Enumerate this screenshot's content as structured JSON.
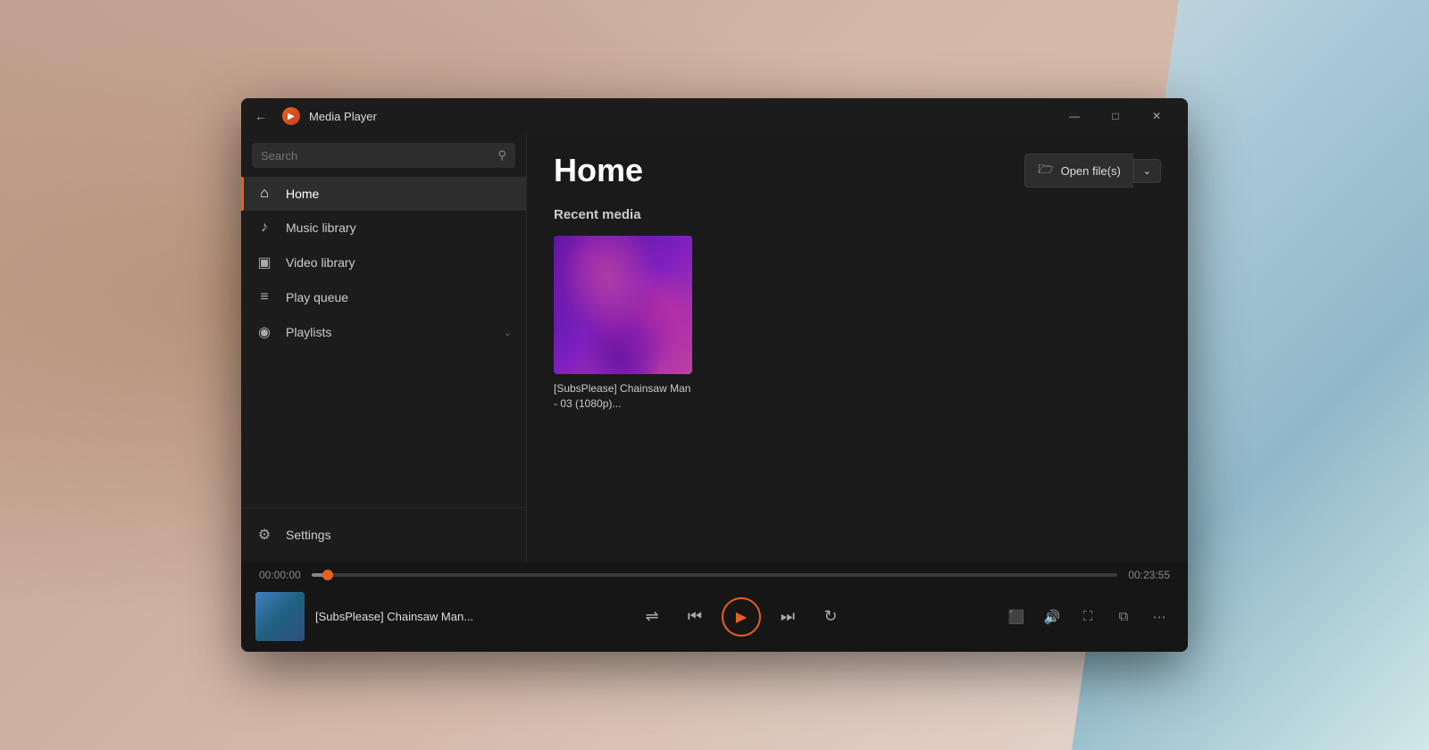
{
  "app": {
    "title": "Media Player",
    "icon": "▶"
  },
  "titlebar": {
    "minimize": "—",
    "maximize": "□",
    "close": "✕"
  },
  "sidebar": {
    "search_placeholder": "Search",
    "nav_items": [
      {
        "id": "home",
        "label": "Home",
        "icon": "⌂",
        "active": true
      },
      {
        "id": "music-library",
        "label": "Music library",
        "icon": "♪"
      },
      {
        "id": "video-library",
        "label": "Video library",
        "icon": "▣"
      },
      {
        "id": "play-queue",
        "label": "Play queue",
        "icon": "≡"
      },
      {
        "id": "playlists",
        "label": "Playlists",
        "icon": "◉",
        "has_chevron": true
      }
    ],
    "settings_label": "Settings"
  },
  "content": {
    "page_title": "Home",
    "open_files_label": "Open file(s)",
    "section_title": "Recent media",
    "media_items": [
      {
        "id": "csm",
        "title": "[SubsPlease] Chainsaw Man - 03 (1080p)..."
      }
    ]
  },
  "player": {
    "current_time": "00:00:00",
    "total_time": "00:23:55",
    "track_title": "[SubsPlease] Chainsaw Man...",
    "progress_percent": 2
  },
  "icons": {
    "back": "←",
    "search": "⚲",
    "folder": "🗁",
    "chevron_down": "⌄",
    "settings_gear": "⚙",
    "shuffle": "⇌",
    "prev": "⏮",
    "play": "▶",
    "next": "⏭",
    "repeat": "↻",
    "miniplayer": "⬛",
    "volume": "🔊",
    "fullscreen": "⛶",
    "pip": "⧉",
    "more": "⋯"
  }
}
